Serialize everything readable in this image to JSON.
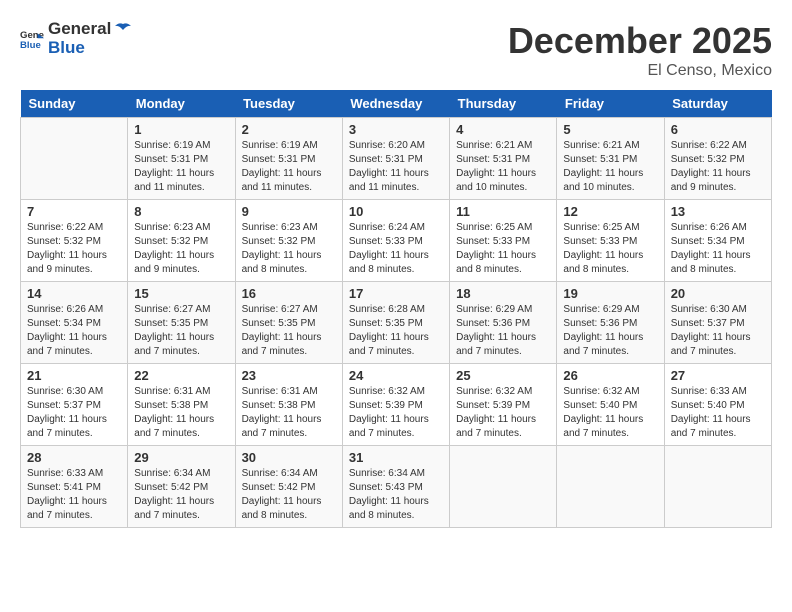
{
  "logo": {
    "general": "General",
    "blue": "Blue"
  },
  "title": "December 2025",
  "location": "El Censo, Mexico",
  "days_of_week": [
    "Sunday",
    "Monday",
    "Tuesday",
    "Wednesday",
    "Thursday",
    "Friday",
    "Saturday"
  ],
  "weeks": [
    [
      {
        "day": "",
        "sunrise": "",
        "sunset": "",
        "daylight": ""
      },
      {
        "day": "1",
        "sunrise": "6:19 AM",
        "sunset": "5:31 PM",
        "daylight": "11 hours and 11 minutes."
      },
      {
        "day": "2",
        "sunrise": "6:19 AM",
        "sunset": "5:31 PM",
        "daylight": "11 hours and 11 minutes."
      },
      {
        "day": "3",
        "sunrise": "6:20 AM",
        "sunset": "5:31 PM",
        "daylight": "11 hours and 11 minutes."
      },
      {
        "day": "4",
        "sunrise": "6:21 AM",
        "sunset": "5:31 PM",
        "daylight": "11 hours and 10 minutes."
      },
      {
        "day": "5",
        "sunrise": "6:21 AM",
        "sunset": "5:31 PM",
        "daylight": "11 hours and 10 minutes."
      },
      {
        "day": "6",
        "sunrise": "6:22 AM",
        "sunset": "5:32 PM",
        "daylight": "11 hours and 9 minutes."
      }
    ],
    [
      {
        "day": "7",
        "sunrise": "6:22 AM",
        "sunset": "5:32 PM",
        "daylight": "11 hours and 9 minutes."
      },
      {
        "day": "8",
        "sunrise": "6:23 AM",
        "sunset": "5:32 PM",
        "daylight": "11 hours and 9 minutes."
      },
      {
        "day": "9",
        "sunrise": "6:23 AM",
        "sunset": "5:32 PM",
        "daylight": "11 hours and 8 minutes."
      },
      {
        "day": "10",
        "sunrise": "6:24 AM",
        "sunset": "5:33 PM",
        "daylight": "11 hours and 8 minutes."
      },
      {
        "day": "11",
        "sunrise": "6:25 AM",
        "sunset": "5:33 PM",
        "daylight": "11 hours and 8 minutes."
      },
      {
        "day": "12",
        "sunrise": "6:25 AM",
        "sunset": "5:33 PM",
        "daylight": "11 hours and 8 minutes."
      },
      {
        "day": "13",
        "sunrise": "6:26 AM",
        "sunset": "5:34 PM",
        "daylight": "11 hours and 8 minutes."
      }
    ],
    [
      {
        "day": "14",
        "sunrise": "6:26 AM",
        "sunset": "5:34 PM",
        "daylight": "11 hours and 7 minutes."
      },
      {
        "day": "15",
        "sunrise": "6:27 AM",
        "sunset": "5:35 PM",
        "daylight": "11 hours and 7 minutes."
      },
      {
        "day": "16",
        "sunrise": "6:27 AM",
        "sunset": "5:35 PM",
        "daylight": "11 hours and 7 minutes."
      },
      {
        "day": "17",
        "sunrise": "6:28 AM",
        "sunset": "5:35 PM",
        "daylight": "11 hours and 7 minutes."
      },
      {
        "day": "18",
        "sunrise": "6:29 AM",
        "sunset": "5:36 PM",
        "daylight": "11 hours and 7 minutes."
      },
      {
        "day": "19",
        "sunrise": "6:29 AM",
        "sunset": "5:36 PM",
        "daylight": "11 hours and 7 minutes."
      },
      {
        "day": "20",
        "sunrise": "6:30 AM",
        "sunset": "5:37 PM",
        "daylight": "11 hours and 7 minutes."
      }
    ],
    [
      {
        "day": "21",
        "sunrise": "6:30 AM",
        "sunset": "5:37 PM",
        "daylight": "11 hours and 7 minutes."
      },
      {
        "day": "22",
        "sunrise": "6:31 AM",
        "sunset": "5:38 PM",
        "daylight": "11 hours and 7 minutes."
      },
      {
        "day": "23",
        "sunrise": "6:31 AM",
        "sunset": "5:38 PM",
        "daylight": "11 hours and 7 minutes."
      },
      {
        "day": "24",
        "sunrise": "6:32 AM",
        "sunset": "5:39 PM",
        "daylight": "11 hours and 7 minutes."
      },
      {
        "day": "25",
        "sunrise": "6:32 AM",
        "sunset": "5:39 PM",
        "daylight": "11 hours and 7 minutes."
      },
      {
        "day": "26",
        "sunrise": "6:32 AM",
        "sunset": "5:40 PM",
        "daylight": "11 hours and 7 minutes."
      },
      {
        "day": "27",
        "sunrise": "6:33 AM",
        "sunset": "5:40 PM",
        "daylight": "11 hours and 7 minutes."
      }
    ],
    [
      {
        "day": "28",
        "sunrise": "6:33 AM",
        "sunset": "5:41 PM",
        "daylight": "11 hours and 7 minutes."
      },
      {
        "day": "29",
        "sunrise": "6:34 AM",
        "sunset": "5:42 PM",
        "daylight": "11 hours and 7 minutes."
      },
      {
        "day": "30",
        "sunrise": "6:34 AM",
        "sunset": "5:42 PM",
        "daylight": "11 hours and 8 minutes."
      },
      {
        "day": "31",
        "sunrise": "6:34 AM",
        "sunset": "5:43 PM",
        "daylight": "11 hours and 8 minutes."
      },
      {
        "day": "",
        "sunrise": "",
        "sunset": "",
        "daylight": ""
      },
      {
        "day": "",
        "sunrise": "",
        "sunset": "",
        "daylight": ""
      },
      {
        "day": "",
        "sunrise": "",
        "sunset": "",
        "daylight": ""
      }
    ]
  ],
  "sunrise_label": "Sunrise:",
  "sunset_label": "Sunset:",
  "daylight_label": "Daylight:"
}
